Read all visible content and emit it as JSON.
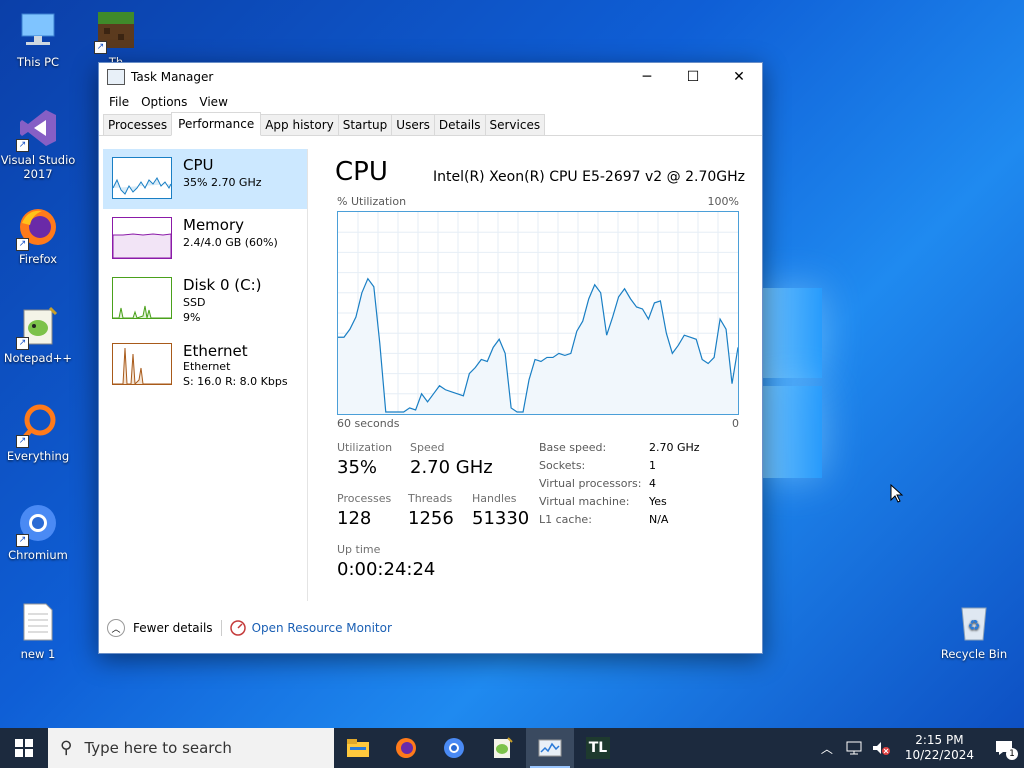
{
  "desktop": {
    "icons": [
      {
        "label": "This PC",
        "icon": "this-pc-icon"
      },
      {
        "label": "Th",
        "icon": "minecraft-icon"
      },
      {
        "label": "Visual Studio 2017",
        "icon": "visual-studio-icon"
      },
      {
        "label": "Firefox",
        "icon": "firefox-icon"
      },
      {
        "label": "Notepad++",
        "icon": "notepadpp-icon"
      },
      {
        "label": "Everything",
        "icon": "everything-icon"
      },
      {
        "label": "Chromium",
        "icon": "chromium-icon"
      },
      {
        "label": "new 1",
        "icon": "text-file-icon"
      },
      {
        "label": "Recycle Bin",
        "icon": "recycle-bin-icon"
      }
    ]
  },
  "window": {
    "title": "Task Manager",
    "minimize": "─",
    "maximize": "☐",
    "close": "✕",
    "menu": [
      "File",
      "Options",
      "View"
    ],
    "tabs": [
      "Processes",
      "Performance",
      "App history",
      "Startup",
      "Users",
      "Details",
      "Services"
    ],
    "active_tab": "Performance"
  },
  "left_pane": {
    "items": [
      {
        "name": "CPU",
        "sub1": "35%  2.70 GHz",
        "color": "#1a7fc4"
      },
      {
        "name": "Memory",
        "sub1": "2.4/4.0 GB (60%)",
        "color": "#8b1aa8"
      },
      {
        "name": "Disk 0 (C:)",
        "sub1": "SSD",
        "sub2": "9%",
        "color": "#4aa11b"
      },
      {
        "name": "Ethernet",
        "sub1": "Ethernet",
        "sub2": "S: 16.0  R: 8.0 Kbps",
        "color": "#a85a1a"
      }
    ]
  },
  "cpu": {
    "title": "CPU",
    "model": "Intel(R) Xeon(R) CPU E5-2697 v2 @ 2.70GHz",
    "util_label": "% Utilization",
    "max_label": "100%",
    "x_left": "60 seconds",
    "x_right": "0",
    "graph_values": [
      38,
      38,
      42,
      48,
      60,
      67,
      63,
      35,
      1,
      1,
      1,
      1,
      3,
      2,
      10,
      6,
      10,
      14,
      12,
      11,
      10,
      9,
      20,
      23,
      27,
      26,
      33,
      37,
      30,
      3,
      1,
      1,
      17,
      27,
      26,
      28,
      28,
      30,
      29,
      30,
      41,
      46,
      57,
      64,
      60,
      39,
      48,
      58,
      62,
      57,
      53,
      52,
      47,
      55,
      56,
      40,
      30,
      34,
      39,
      38,
      37,
      27,
      25,
      28,
      47,
      42,
      15,
      33
    ],
    "stats": {
      "utilization_label": "Utilization",
      "utilization": "35%",
      "speed_label": "Speed",
      "speed": "2.70 GHz",
      "processes_label": "Processes",
      "processes": "128",
      "threads_label": "Threads",
      "threads": "1256",
      "handles_label": "Handles",
      "handles": "51330",
      "uptime_label": "Up time",
      "uptime": "0:00:24:24"
    },
    "details": [
      {
        "k": "Base speed:",
        "v": "2.70 GHz"
      },
      {
        "k": "Sockets:",
        "v": "1"
      },
      {
        "k": "Virtual processors:",
        "v": "4"
      },
      {
        "k": "Virtual machine:",
        "v": "Yes"
      },
      {
        "k": "L1 cache:",
        "v": "N/A"
      }
    ]
  },
  "footer": {
    "fewer_details": "Fewer details",
    "open_resource_monitor": "Open Resource Monitor"
  },
  "taskbar": {
    "search_placeholder": "Type here to search",
    "apps": [
      "file-explorer-icon",
      "firefox-icon",
      "chromium-icon",
      "notepadpp-icon",
      "task-manager-icon",
      "tl-app-icon"
    ],
    "tl_label": "TL",
    "time": "2:15 PM",
    "date": "10/22/2024",
    "notif_count": "1"
  }
}
